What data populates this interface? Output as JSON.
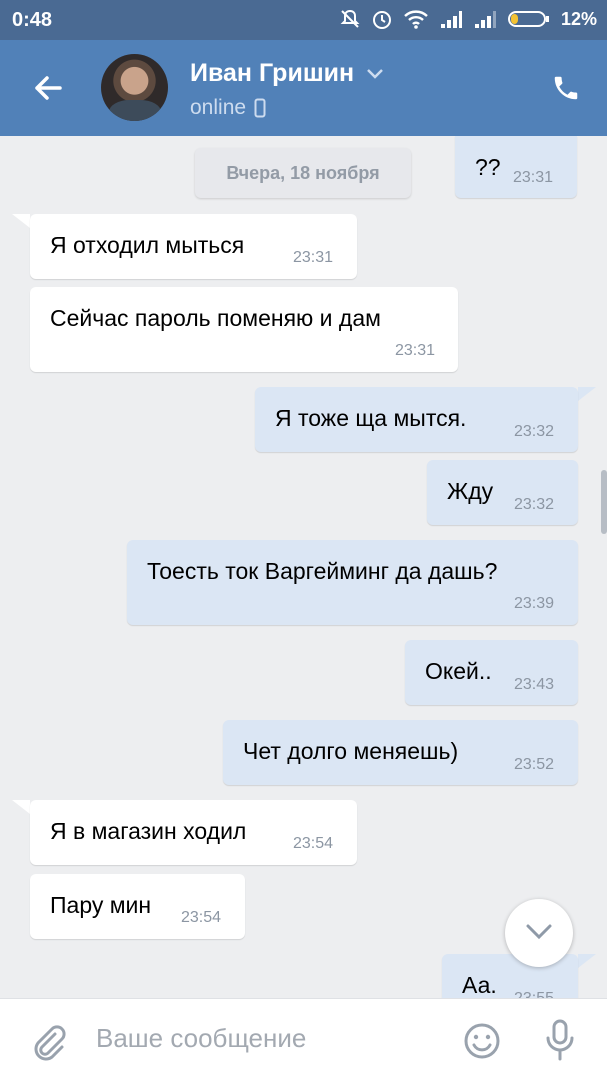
{
  "status_bar": {
    "time": "0:48",
    "battery": "12%"
  },
  "header": {
    "name": "Иван Гришин",
    "status": "online"
  },
  "chat": {
    "date_separator": "Вчера, 18 ноября",
    "messages": [
      {
        "dir": "out",
        "text": "??",
        "time": "23:31"
      },
      {
        "dir": "in",
        "text": "Я отходил мыться",
        "time": "23:31"
      },
      {
        "dir": "in",
        "text": "Сейчас пароль поменяю и дам",
        "time": "23:31"
      },
      {
        "dir": "out",
        "text": "Я тоже ща мытся.",
        "time": "23:32"
      },
      {
        "dir": "out",
        "text": "Жду",
        "time": "23:32"
      },
      {
        "dir": "out",
        "text": "Тоесть ток Варгейминг да дашь?",
        "time": "23:39"
      },
      {
        "dir": "out",
        "text": "Окей..",
        "time": "23:43"
      },
      {
        "dir": "out",
        "text": "Чет долго меняешь)",
        "time": "23:52"
      },
      {
        "dir": "in",
        "text": "Я в магазин ходил",
        "time": "23:54"
      },
      {
        "dir": "in",
        "text": "Пару мин",
        "time": "23:54"
      },
      {
        "dir": "out",
        "text": "Аа.",
        "time": "23:55"
      }
    ]
  },
  "composer": {
    "placeholder": "Ваше сообщение"
  },
  "icons": {
    "back": "arrow-left-icon",
    "phone": "phone-icon",
    "chevron": "chevron-down-icon",
    "mobile": "mobile-phone-icon",
    "attach": "paperclip-icon",
    "emoji": "smile-icon",
    "mic": "microphone-icon",
    "scroll": "chevron-down-icon"
  },
  "colors": {
    "header": "#5181b8",
    "status_bar": "#4a6a93",
    "incoming": "#ffffff",
    "outgoing": "#dbe6f4",
    "background": "#edeef0"
  }
}
